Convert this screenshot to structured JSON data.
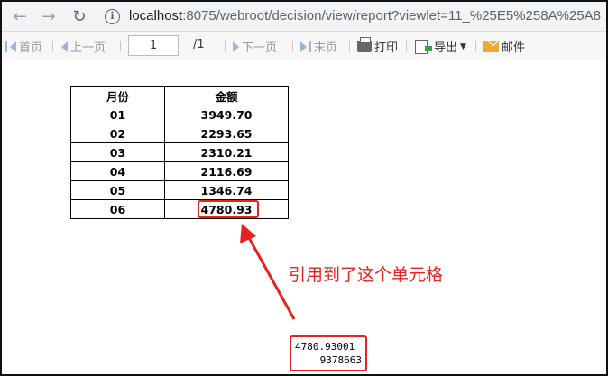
{
  "browser": {
    "url_host": "localhost",
    "url_rest": ":8075/webroot/decision/view/report?viewlet=11_%25E5%258A%25A8"
  },
  "toolbar": {
    "first_page": "首页",
    "prev_page": "上一页",
    "current_page": "1",
    "total_pages": "/1",
    "next_page": "下一页",
    "last_page": "末页",
    "print": "打印",
    "export": "导出",
    "mail": "邮件"
  },
  "report": {
    "headers": [
      "月份",
      "金额"
    ],
    "rows": [
      [
        "01",
        "3949.70"
      ],
      [
        "02",
        "2293.65"
      ],
      [
        "03",
        "2310.21"
      ],
      [
        "04",
        "2116.69"
      ],
      [
        "05",
        "1346.74"
      ],
      [
        "06",
        "4780.93"
      ]
    ]
  },
  "annotation": {
    "text": "引用到了这个单元格",
    "color": "#e8231f"
  },
  "result": {
    "line1": "4780.93001",
    "line2": "9378663"
  }
}
